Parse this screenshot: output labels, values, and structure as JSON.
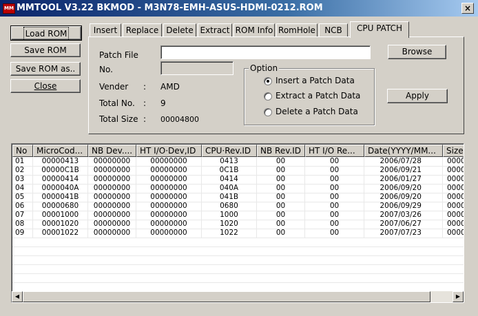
{
  "window": {
    "title": "MMTOOL V3.22 BKMOD - M3N78-EMH-ASUS-HDMI-0212.ROM",
    "icon": "app-icon",
    "close_label": "×"
  },
  "left_buttons": {
    "load_rom": "Load ROM",
    "save_rom": "Save ROM",
    "save_rom_as": "Save ROM as..",
    "close": "Close"
  },
  "tabs": [
    {
      "label": "Insert"
    },
    {
      "label": "Replace"
    },
    {
      "label": "Delete"
    },
    {
      "label": "Extract"
    },
    {
      "label": "ROM Info"
    },
    {
      "label": "RomHole"
    },
    {
      "label": "NCB"
    },
    {
      "label": "CPU PATCH",
      "active": true
    }
  ],
  "patch": {
    "patch_file_label": "Patch File",
    "patch_file_value": "",
    "no_label": "No.",
    "no_value": "",
    "vender_label": "Vender",
    "vender_colon": ":",
    "vender_value": "AMD",
    "total_no_label": "Total No.",
    "total_no_colon": ":",
    "total_no_value": "9",
    "total_size_label": "Total Size",
    "total_size_colon": ":",
    "total_size_value": "00004800",
    "browse_label": "Browse",
    "apply_label": "Apply"
  },
  "option": {
    "legend": "Option",
    "items": [
      {
        "label": "Insert a Patch Data",
        "checked": true
      },
      {
        "label": "Extract a Patch Data",
        "checked": false
      },
      {
        "label": "Delete a Patch Data",
        "checked": false
      }
    ]
  },
  "table": {
    "columns": [
      "No",
      "MicroCod...",
      "NB Dev....",
      "HT I/O·Dev,ID",
      "CPU·Rev.ID",
      "NB Rev.ID",
      "HT I/O Re...",
      "Date(YYYY/MM...",
      "Size"
    ],
    "rows": [
      [
        "01",
        "00000413",
        "00000000",
        "00000000",
        "0413",
        "00",
        "00",
        "2006/07/28",
        "0000"
      ],
      [
        "02",
        "00000C1B",
        "00000000",
        "00000000",
        "0C1B",
        "00",
        "00",
        "2006/09/21",
        "0000"
      ],
      [
        "03",
        "00000414",
        "00000000",
        "00000000",
        "0414",
        "00",
        "00",
        "2006/01/27",
        "0000"
      ],
      [
        "04",
        "0000040A",
        "00000000",
        "00000000",
        "040A",
        "00",
        "00",
        "2006/09/20",
        "0000"
      ],
      [
        "05",
        "0000041B",
        "00000000",
        "00000000",
        "041B",
        "00",
        "00",
        "2006/09/20",
        "0000"
      ],
      [
        "06",
        "00000680",
        "00000000",
        "00000000",
        "0680",
        "00",
        "00",
        "2006/09/29",
        "0000"
      ],
      [
        "07",
        "00001000",
        "00000000",
        "00000000",
        "1000",
        "00",
        "00",
        "2007/03/26",
        "0000"
      ],
      [
        "08",
        "00001020",
        "00000000",
        "00000000",
        "1020",
        "00",
        "00",
        "2007/06/27",
        "0000"
      ],
      [
        "09",
        "00001022",
        "00000000",
        "00000000",
        "1022",
        "00",
        "00",
        "2007/07/23",
        "0000"
      ]
    ]
  },
  "scrollbar": {
    "left_arrow": "◀",
    "right_arrow": "▶"
  }
}
